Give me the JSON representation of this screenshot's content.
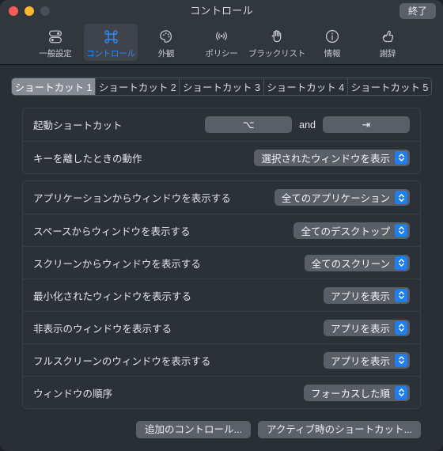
{
  "window": {
    "title": "コントロール",
    "quit_label": "終了",
    "traffic_lights": [
      "close-red",
      "minimize-yellow",
      "zoom-disabled"
    ]
  },
  "toolbar": {
    "items": [
      {
        "label": "一般設定",
        "icon": "toggles-icon",
        "selected": false
      },
      {
        "label": "コントロール",
        "icon": "command-icon",
        "selected": true
      },
      {
        "label": "外観",
        "icon": "palette-icon",
        "selected": false
      },
      {
        "label": "ポリシー",
        "icon": "broadcast-icon",
        "selected": false
      },
      {
        "label": "ブラックリスト",
        "icon": "hand-icon",
        "selected": false
      },
      {
        "label": "情報",
        "icon": "info-icon",
        "selected": false
      },
      {
        "label": "謝辞",
        "icon": "thumbs-up-icon",
        "selected": false
      }
    ],
    "accent_color": "#2d8cf8"
  },
  "tabs": [
    {
      "label": "ショートカット 1",
      "selected": true
    },
    {
      "label": "ショートカット 2",
      "selected": false
    },
    {
      "label": "ショートカット 3",
      "selected": false
    },
    {
      "label": "ショートカット 4",
      "selected": false
    },
    {
      "label": "ショートカット 5",
      "selected": false
    }
  ],
  "launch_group": {
    "shortcut_row": {
      "label": "起動ショートカット",
      "modifier_key": "⌥",
      "conjunction": "and",
      "trigger_key": "⇥"
    },
    "release_row": {
      "label": "キーを離したときの動作",
      "value": "選択されたウィンドウを表示"
    }
  },
  "windows_group": {
    "rows": [
      {
        "label": "アプリケーションからウィンドウを表示する",
        "value": "全てのアプリケーション"
      },
      {
        "label": "スペースからウィンドウを表示する",
        "value": "全てのデスクトップ"
      },
      {
        "label": "スクリーンからウィンドウを表示する",
        "value": "全てのスクリーン"
      },
      {
        "label": "最小化されたウィンドウを表示する",
        "value": "アプリを表示"
      },
      {
        "label": "非表示のウィンドウを表示する",
        "value": "アプリを表示"
      },
      {
        "label": "フルスクリーンのウィンドウを表示する",
        "value": "アプリを表示"
      },
      {
        "label": "ウィンドウの順序",
        "value": "フォーカスした順"
      }
    ]
  },
  "bottom_buttons": [
    {
      "label": "追加のコントロール..."
    },
    {
      "label": "アクティブ時のショートカット..."
    }
  ],
  "colors": {
    "accent": "#2d8cf8",
    "popup_arrow_blue": "#1d7ff2",
    "window_bg": "#2a2e35",
    "titlebar_bg": "#32363d"
  }
}
